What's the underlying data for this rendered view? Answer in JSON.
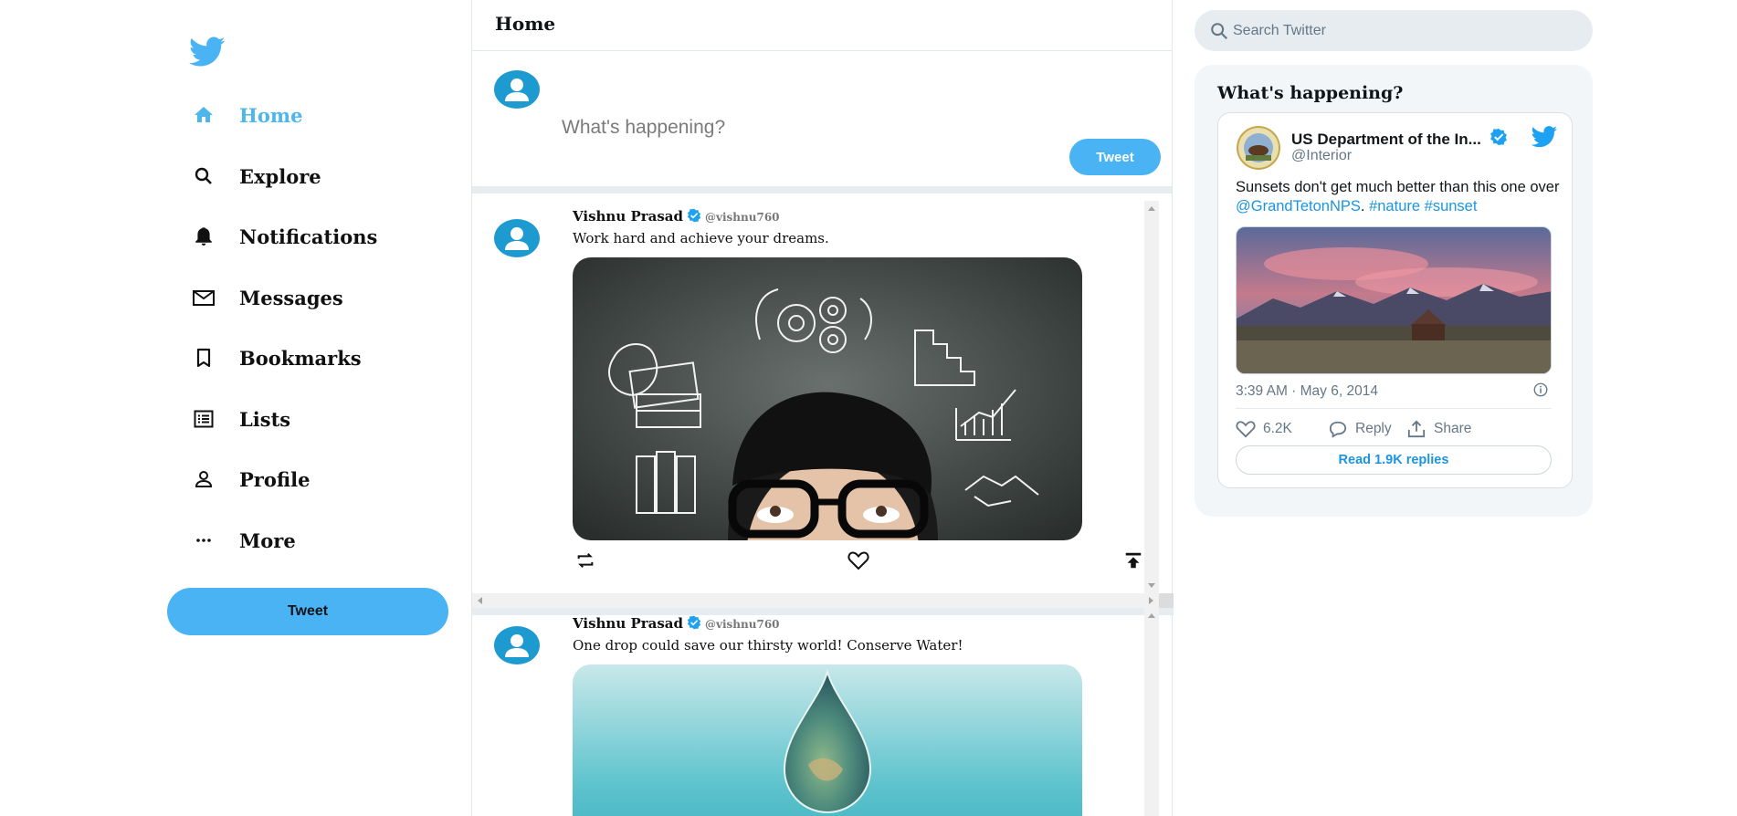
{
  "colors": {
    "accent": "#4ab3f4",
    "active_nav": "#4fb6ec",
    "avatar": "#1d9bd1",
    "link": "#1b95e0",
    "verified": "#1da1f2"
  },
  "sidebar": {
    "logo_icon": "twitter-bird-icon",
    "items": [
      {
        "label": "Home",
        "icon": "home-icon",
        "active": true
      },
      {
        "label": "Explore",
        "icon": "search-icon"
      },
      {
        "label": "Notifications",
        "icon": "bell-icon"
      },
      {
        "label": "Messages",
        "icon": "mail-icon"
      },
      {
        "label": "Bookmarks",
        "icon": "bookmark-icon"
      },
      {
        "label": "Lists",
        "icon": "list-icon"
      },
      {
        "label": "Profile",
        "icon": "person-icon"
      },
      {
        "label": "More",
        "icon": "more-dots-icon"
      }
    ],
    "tweet_label": "Tweet"
  },
  "main": {
    "title": "Home",
    "composer": {
      "placeholder": "What's happening?",
      "tweet_label": "Tweet"
    },
    "posts": [
      {
        "author": "Vishnu Prasad",
        "handle": "@vishnu760",
        "text": "Work hard and achieve your dreams."
      },
      {
        "author": "Vishnu Prasad",
        "handle": "@vishnu760",
        "text": "One drop could save our thirsty world! Conserve Water!"
      }
    ]
  },
  "right": {
    "search_placeholder": "Search Twitter",
    "trends_title": "What's happening?",
    "embed": {
      "name": "US Department of the In...",
      "handle": "@Interior",
      "text_pre": "Sunsets don't get much better than this one over ",
      "mention": "@GrandTetonNPS",
      "text_mid": ". ",
      "hashtag1": "#nature",
      "hashtag2": "#sunset",
      "time": "3:39 AM · May 6, 2014",
      "likes": "6.2K",
      "reply_label": "Reply",
      "share_label": "Share",
      "read_replies": "Read 1.9K replies"
    }
  }
}
